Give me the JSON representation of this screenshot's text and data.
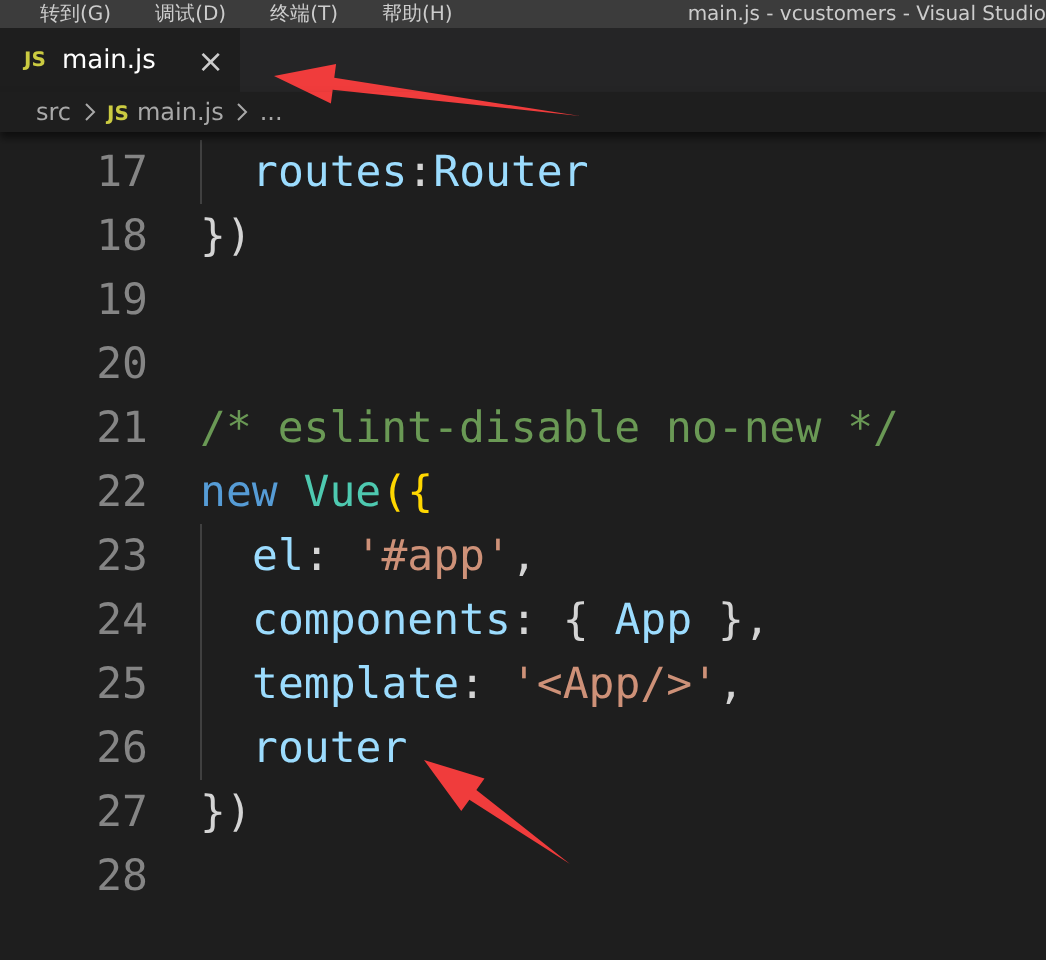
{
  "menu_bar": {
    "items": [
      "转到(G)",
      "调试(D)",
      "终端(T)",
      "帮助(H)"
    ],
    "title": "main.js - vcustomers - Visual Studio"
  },
  "tabs": [
    {
      "icon_text": "JS",
      "label": "main.js",
      "close": "×",
      "selected": true
    }
  ],
  "breadcrumb": [
    {
      "text": "src",
      "kind": "folder"
    },
    {
      "text": "main.js",
      "kind": "file",
      "icon_text": "JS"
    },
    {
      "text": "...",
      "kind": "more"
    }
  ],
  "editor": {
    "lines": [
      {
        "number": "17",
        "indented": true,
        "tokens": [
          {
            "text": "routes",
            "kind": "property"
          },
          {
            "text": ":",
            "kind": "punct"
          },
          {
            "text": "Router",
            "kind": "property"
          }
        ]
      },
      {
        "number": "18",
        "indented": false,
        "tokens": [
          {
            "text": "})",
            "kind": "punct"
          }
        ]
      },
      {
        "number": "19",
        "indented": false
      },
      {
        "number": "20",
        "indented": false
      },
      {
        "number": "21",
        "indented": false,
        "tokens": [
          {
            "text": "/* eslint-disable no-new */",
            "kind": "comment"
          }
        ]
      },
      {
        "number": "22",
        "indented": false,
        "tokens": [
          {
            "text": "new",
            "kind": "keyword"
          },
          {
            "text": " Vue",
            "kind": "class"
          },
          {
            "text": "({",
            "kind": "bracket"
          }
        ]
      },
      {
        "number": "23",
        "indented": true,
        "tokens": [
          {
            "text": "el",
            "kind": "property"
          },
          {
            "text": ": ",
            "kind": "punct"
          },
          {
            "text": "'#app'",
            "kind": "string"
          },
          {
            "text": ",",
            "kind": "punct"
          }
        ]
      },
      {
        "number": "24",
        "indented": true,
        "tokens": [
          {
            "text": "components",
            "kind": "property"
          },
          {
            "text": ": { ",
            "kind": "punct"
          },
          {
            "text": "App",
            "kind": "property"
          },
          {
            "text": " },",
            "kind": "punct"
          }
        ]
      },
      {
        "number": "25",
        "indented": true,
        "tokens": [
          {
            "text": "template",
            "kind": "property"
          },
          {
            "text": ": ",
            "kind": "punct"
          },
          {
            "text": "'<App/>'",
            "kind": "string"
          },
          {
            "text": ",",
            "kind": "punct"
          }
        ]
      },
      {
        "number": "26",
        "indented": true,
        "tokens": [
          {
            "text": "router",
            "kind": "property"
          }
        ]
      },
      {
        "number": "27",
        "indented": false,
        "tokens": [
          {
            "text": "})",
            "kind": "punct"
          }
        ]
      },
      {
        "number": "28",
        "indented": false
      }
    ]
  }
}
